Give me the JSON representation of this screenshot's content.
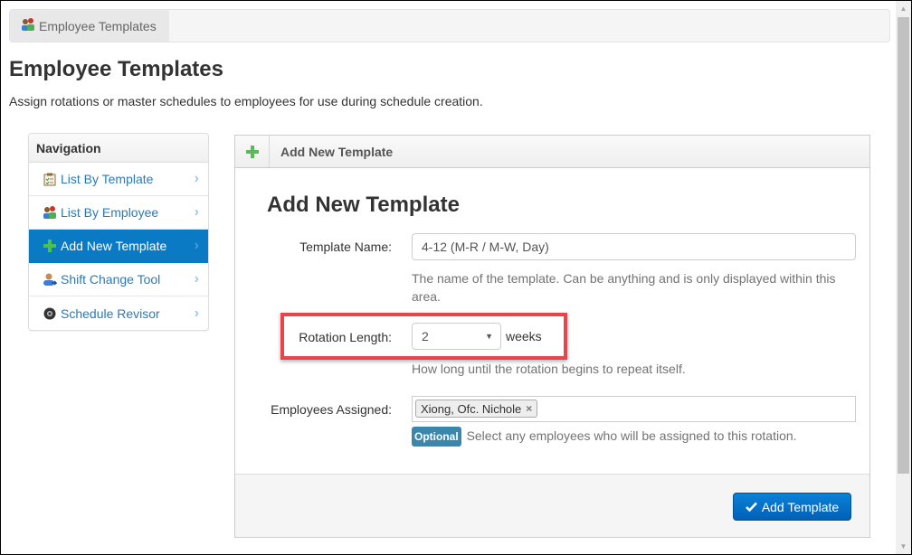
{
  "breadcrumb": {
    "label": "Employee Templates",
    "icon": "users-icon"
  },
  "header": {
    "title": "Employee Templates",
    "subtitle": "Assign rotations or master schedules to employees for use during schedule creation."
  },
  "sidebar": {
    "heading": "Navigation",
    "items": [
      {
        "label": "List By Template",
        "icon": "clipboard-check-icon",
        "active": false
      },
      {
        "label": "List By Employee",
        "icon": "users-icon",
        "active": false
      },
      {
        "label": "Add New Template",
        "icon": "plus-icon",
        "active": true
      },
      {
        "label": "Shift Change Tool",
        "icon": "user-swap-icon",
        "active": false
      },
      {
        "label": "Schedule Revisor",
        "icon": "disc-icon",
        "active": false
      }
    ],
    "chevron": "›"
  },
  "panel": {
    "header_title": "Add New Template",
    "heading": "Add New Template",
    "fields": {
      "template_name": {
        "label": "Template Name:",
        "value": "4-12 (M-R / M-W, Day)",
        "help": "The name of the template. Can be anything and is only displayed within this area."
      },
      "rotation_length": {
        "label": "Rotation Length:",
        "value": "2",
        "unit": "weeks",
        "help": "How long until the rotation begins to repeat itself."
      },
      "employees_assigned": {
        "label": "Employees Assigned:",
        "tags": [
          "Xiong, Ofc. Nichole"
        ],
        "badge": "Optional",
        "help": "Select any employees who will be assigned to this rotation."
      }
    },
    "submit_label": "Add Template"
  },
  "colors": {
    "accent": "#0a7ac4",
    "link": "#2a7ab8",
    "highlight": "#e8444c",
    "button": "#0070c9",
    "badge": "#3a87ad"
  }
}
